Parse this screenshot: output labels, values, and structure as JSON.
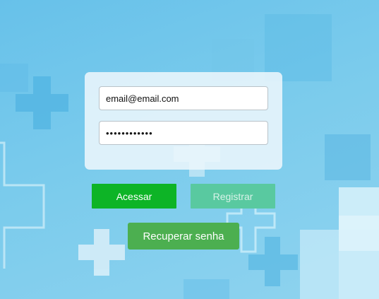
{
  "login_form": {
    "email_value": "email@email.com",
    "password_value": "••••••••••••"
  },
  "actions": {
    "login_label": "Acessar",
    "register_label": "Registrar",
    "recover_label": "Recuperar senha"
  },
  "colors": {
    "background": "#6ec6ea",
    "login_button": "#0db426",
    "register_button": "#59c9a0",
    "recover_button": "#4caf50"
  },
  "icons": [
    "medical-cross-icon"
  ]
}
